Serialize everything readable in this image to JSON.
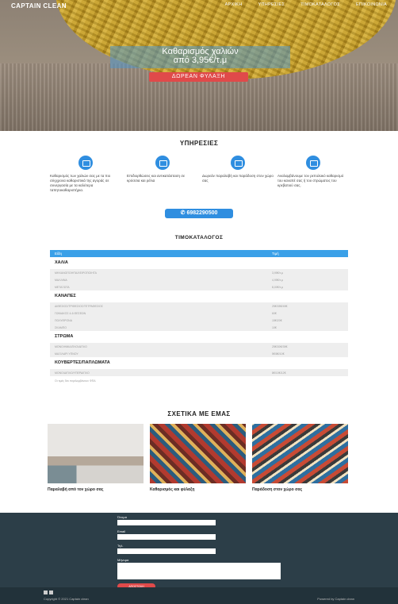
{
  "header": {
    "logo": "CAPTAIN CLEAN",
    "nav": [
      "ΑΡΧΙΚΗ",
      "ΥΠΗΡΕΣΙΕΣ",
      "ΤΙΜΟΚΑΤΑΛΟΓΟΣ",
      "ΕΠΙΚΟΙΝΩΝΙΑ"
    ]
  },
  "hero": {
    "title_line1": "Καθαρισμός χαλιών",
    "title_line2": "από 3,95€/τ.μ",
    "button": "ΔΩΡΕΑΝ ΦΥΛΑΞΗ"
  },
  "services": {
    "title": "ΥΠΗΡΕΣΙΕΣ",
    "items": [
      {
        "icon": "carpet-icon",
        "text": "Καθαρισμός των χαλιών σας με τα πιο σύγχρονα καθαριστικά της αγοράς σε συνεργασία με τα καλύτερα ταπητοκαθαριστήρια."
      },
      {
        "icon": "repair-icon",
        "text": "Επιδιορθώσεις και αντικατάσταση σε κρόσσια και ρέλια"
      },
      {
        "icon": "truck-icon",
        "text": "Δωρεάν παραλαβή και παράδοση στον χώρο σας"
      },
      {
        "icon": "sofa-icon",
        "text": "Αναλαμβάνουμε τον ρεπολακό καθαρισμό του καναπέ σας ή του στρώματος του κρεβατιού σας."
      }
    ],
    "phone": "6982290500"
  },
  "pricing": {
    "title": "ΤΙΜΟΚΑΤΑΛΟΓΟΣ",
    "col_type": "Είδη",
    "col_price": "Τιμή",
    "categories": [
      {
        "name": "ΧΑΛΙΑ",
        "rows": [
          [
            "ΜΗΧΑΝΟΠΟΙΗΤΑ/ΧΕΙΡΟΠΟΙΗΤΑ",
            "3,95€/τ.μ"
          ],
          [
            "ΜΑΛΛΙΝΑ",
            "4,95€/τ.μ"
          ],
          [
            "ΜΕΤΑΞΩΤΑ",
            "8,00€/τ.μ"
          ]
        ]
      },
      {
        "name": "ΚΑΝΑΠΕΣ",
        "rows": [
          [
            "ΔΙΘΕΣΙΟΣ/ΤΡΙΘΕΣΙΟΣ/ΤΕΤΡΑΘΕΣΙΟΣ",
            "25€/35€/45€"
          ],
          [
            "ΓΩΝΙΑΚΟΣ 4-6 ΘΕΣΕΩΝ",
            "60€"
          ],
          [
            "ΠΟΛΥΘΡΟΝΑ",
            "15€/20€"
          ],
          [
            "ΣΚΑΜΠΟ",
            "10€"
          ]
        ]
      },
      {
        "name": "ΣΤΡΩΜΑ",
        "rows": [
          [
            "ΜΟΝΟ/ΗΜΙΔΙΠΛΟ/ΔΙΠΛΟ",
            "25€/30€/35€"
          ],
          [
            "ΜΑΞΙΛΑΡΙ ΥΠΝΟΥ",
            "5€/8€/10€"
          ]
        ]
      },
      {
        "name": "ΚΟΥΒΕΡΤΕΣ/ΠΑΠΛΩΜΑΤΑ",
        "rows": [
          [
            "ΜΟΝΟ/ΔΙΠΛΟ/ΥΠΕΡΔΙΠΛΟ",
            "8€/10€/12€"
          ]
        ]
      }
    ],
    "note": "Οι τιμές δεν περιλαμβάνουν ΦΠΑ"
  },
  "about": {
    "title": "ΣΧΕΤΙΚΑ ΜΕ ΕΜΑΣ",
    "items": [
      "Παραλαβή από τον χώρο σας",
      "Καθαρισμός και φύλαξη",
      "Παράδοση στον χώρο σας"
    ]
  },
  "contact": {
    "name_label": "Όνομα",
    "email_label": "Email",
    "phone_label": "Τηλ.",
    "message_label": "Μήνυμα",
    "send": "ΑΠΟΣΤΟΛΗ"
  },
  "footer": {
    "copyright": "Copyright © 2021 Captain clean",
    "powered": "Powered by Captain clean"
  },
  "colors": {
    "accent": "#2f8ee0",
    "cta": "#e04a4a",
    "footer": "#2c3e48"
  }
}
